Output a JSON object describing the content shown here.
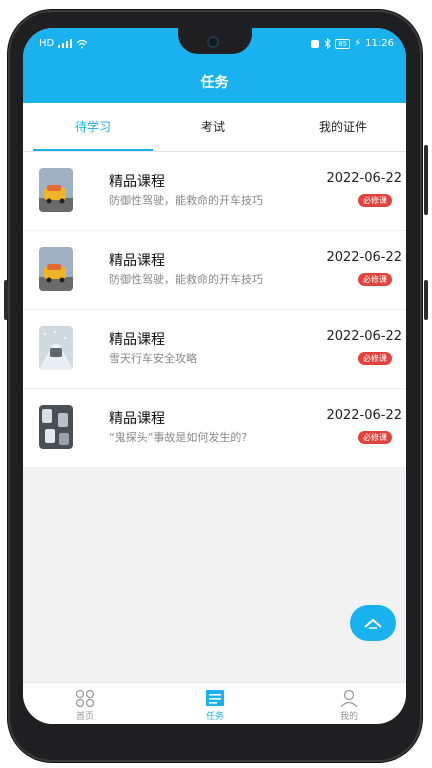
{
  "status_bar": {
    "left_text": "HD",
    "time": "11:26",
    "battery": "85"
  },
  "header": {
    "title": "任务"
  },
  "tabs": [
    {
      "label": "待学习",
      "active": true
    },
    {
      "label": "考试",
      "active": false
    },
    {
      "label": "我的证件",
      "active": false
    }
  ],
  "courses": [
    {
      "title": "精品课程",
      "subtitle": "防御性驾驶，能救命的开车技巧",
      "date": "2022-06-22",
      "badge": "必修课",
      "thumb": "taxi-image"
    },
    {
      "title": "精品课程",
      "subtitle": "防御性驾驶，能救命的开车技巧",
      "date": "2022-06-22",
      "badge": "必修课",
      "thumb": "taxi-image"
    },
    {
      "title": "精品课程",
      "subtitle": "雪天行车安全攻略",
      "date": "2022-06-22",
      "badge": "必修课",
      "thumb": "snow-road-image"
    },
    {
      "title": "精品课程",
      "subtitle": "“鬼探头”事故是如何发生的?",
      "date": "2022-06-22",
      "badge": "必修课",
      "thumb": "traffic-image"
    }
  ],
  "bottom_nav": [
    {
      "label": "首页",
      "icon": "grid-icon",
      "active": false
    },
    {
      "label": "任务",
      "icon": "task-list-icon",
      "active": true
    },
    {
      "label": "我的",
      "icon": "user-icon",
      "active": false
    }
  ],
  "colors": {
    "accent": "#1ab2ee",
    "badge": "#e2423d"
  }
}
